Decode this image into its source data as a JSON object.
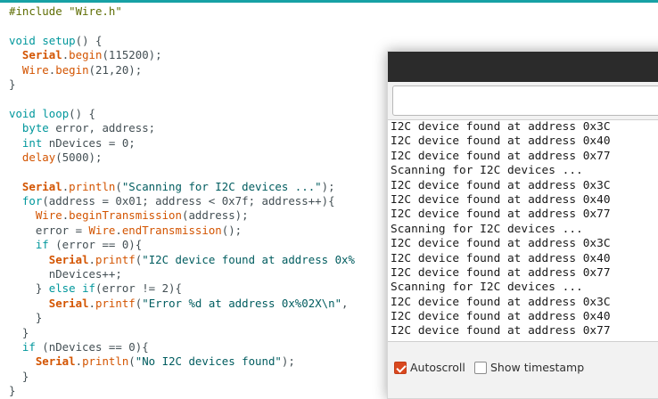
{
  "editor": {
    "lines": [
      [
        {
          "t": "pp",
          "v": "#include \"Wire.h\""
        }
      ],
      [
        {
          "t": "",
          "v": ""
        }
      ],
      [
        {
          "t": "kw",
          "v": "void"
        },
        {
          "t": "",
          "v": " "
        },
        {
          "t": "kw",
          "v": "setup"
        },
        {
          "t": "",
          "v": "() {"
        }
      ],
      [
        {
          "t": "",
          "v": "  "
        },
        {
          "t": "fnb",
          "v": "Serial"
        },
        {
          "t": "",
          "v": "."
        },
        {
          "t": "fn",
          "v": "begin"
        },
        {
          "t": "",
          "v": "(115200);"
        }
      ],
      [
        {
          "t": "",
          "v": "  "
        },
        {
          "t": "fn",
          "v": "Wire"
        },
        {
          "t": "",
          "v": "."
        },
        {
          "t": "fn",
          "v": "begin"
        },
        {
          "t": "",
          "v": "(21,20);"
        }
      ],
      [
        {
          "t": "",
          "v": "}"
        }
      ],
      [
        {
          "t": "",
          "v": ""
        }
      ],
      [
        {
          "t": "kw",
          "v": "void"
        },
        {
          "t": "",
          "v": " "
        },
        {
          "t": "kw",
          "v": "loop"
        },
        {
          "t": "",
          "v": "() {"
        }
      ],
      [
        {
          "t": "",
          "v": "  "
        },
        {
          "t": "kw",
          "v": "byte"
        },
        {
          "t": "",
          "v": " error, address;"
        }
      ],
      [
        {
          "t": "",
          "v": "  "
        },
        {
          "t": "kw",
          "v": "int"
        },
        {
          "t": "",
          "v": " nDevices = 0;"
        }
      ],
      [
        {
          "t": "",
          "v": "  "
        },
        {
          "t": "fn",
          "v": "delay"
        },
        {
          "t": "",
          "v": "(5000);"
        }
      ],
      [
        {
          "t": "",
          "v": ""
        }
      ],
      [
        {
          "t": "",
          "v": "  "
        },
        {
          "t": "fnb",
          "v": "Serial"
        },
        {
          "t": "",
          "v": "."
        },
        {
          "t": "fn",
          "v": "println"
        },
        {
          "t": "",
          "v": "("
        },
        {
          "t": "str",
          "v": "\"Scanning for I2C devices ...\""
        },
        {
          "t": "",
          "v": ");"
        }
      ],
      [
        {
          "t": "",
          "v": "  "
        },
        {
          "t": "kw",
          "v": "for"
        },
        {
          "t": "",
          "v": "(address = 0x01; address < 0x7f; address++){"
        }
      ],
      [
        {
          "t": "",
          "v": "    "
        },
        {
          "t": "fn",
          "v": "Wire"
        },
        {
          "t": "",
          "v": "."
        },
        {
          "t": "fn",
          "v": "beginTransmission"
        },
        {
          "t": "",
          "v": "(address);"
        }
      ],
      [
        {
          "t": "",
          "v": "    error = "
        },
        {
          "t": "fn",
          "v": "Wire"
        },
        {
          "t": "",
          "v": "."
        },
        {
          "t": "fn",
          "v": "endTransmission"
        },
        {
          "t": "",
          "v": "();"
        }
      ],
      [
        {
          "t": "",
          "v": "    "
        },
        {
          "t": "kw",
          "v": "if"
        },
        {
          "t": "",
          "v": " (error == 0){"
        }
      ],
      [
        {
          "t": "",
          "v": "      "
        },
        {
          "t": "fnb",
          "v": "Serial"
        },
        {
          "t": "",
          "v": "."
        },
        {
          "t": "fn",
          "v": "printf"
        },
        {
          "t": "",
          "v": "("
        },
        {
          "t": "str",
          "v": "\"I2C device found at address 0x%"
        }
      ],
      [
        {
          "t": "",
          "v": "      nDevices++;"
        }
      ],
      [
        {
          "t": "",
          "v": "    } "
        },
        {
          "t": "kw",
          "v": "else"
        },
        {
          "t": "",
          "v": " "
        },
        {
          "t": "kw",
          "v": "if"
        },
        {
          "t": "",
          "v": "(error != 2){"
        }
      ],
      [
        {
          "t": "",
          "v": "      "
        },
        {
          "t": "fnb",
          "v": "Serial"
        },
        {
          "t": "",
          "v": "."
        },
        {
          "t": "fn",
          "v": "printf"
        },
        {
          "t": "",
          "v": "("
        },
        {
          "t": "str",
          "v": "\"Error %d at address 0x%02X\\n\""
        },
        {
          "t": "",
          "v": ","
        }
      ],
      [
        {
          "t": "",
          "v": "    }"
        }
      ],
      [
        {
          "t": "",
          "v": "  }"
        }
      ],
      [
        {
          "t": "",
          "v": "  "
        },
        {
          "t": "kw",
          "v": "if"
        },
        {
          "t": "",
          "v": " (nDevices == 0){"
        }
      ],
      [
        {
          "t": "",
          "v": "    "
        },
        {
          "t": "fnb",
          "v": "Serial"
        },
        {
          "t": "",
          "v": "."
        },
        {
          "t": "fn",
          "v": "println"
        },
        {
          "t": "",
          "v": "("
        },
        {
          "t": "str",
          "v": "\"No I2C devices found\""
        },
        {
          "t": "",
          "v": ");"
        }
      ],
      [
        {
          "t": "",
          "v": "  }"
        }
      ],
      [
        {
          "t": "",
          "v": "}"
        }
      ]
    ]
  },
  "serial_monitor": {
    "input_value": "",
    "output_lines": [
      "I2C device found at address 0x3C",
      "I2C device found at address 0x40",
      "I2C device found at address 0x77",
      "Scanning for I2C devices ...",
      "I2C device found at address 0x3C",
      "I2C device found at address 0x40",
      "I2C device found at address 0x77",
      "Scanning for I2C devices ...",
      "I2C device found at address 0x3C",
      "I2C device found at address 0x40",
      "I2C device found at address 0x77",
      "Scanning for I2C devices ...",
      "I2C device found at address 0x3C",
      "I2C device found at address 0x40",
      "I2C device found at address 0x77"
    ],
    "autoscroll_label": "Autoscroll",
    "autoscroll_checked": true,
    "timestamp_label": "Show timestamp",
    "timestamp_checked": false
  },
  "colors": {
    "accent": "#17a1a5",
    "keyword": "#00979c",
    "function": "#d35400",
    "string": "#005c5f",
    "preprocessor": "#5e6d03",
    "checkbox": "#d9481f"
  }
}
